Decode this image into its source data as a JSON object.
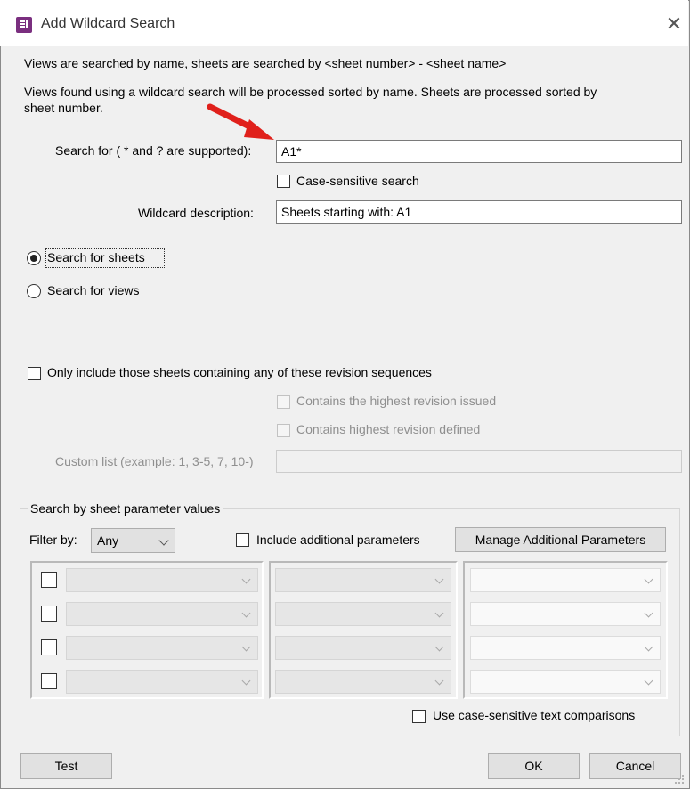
{
  "window": {
    "title": "Add Wildcard Search",
    "icon": "app-logo-icon",
    "close_glyph": "✕"
  },
  "intro": {
    "line1": "Views are searched by name, sheets are searched by <sheet number> - <sheet name>",
    "line2a": "Views found using a wildcard search will be processed sorted by name.  Sheets are processed sorted by",
    "line2b": "sheet number."
  },
  "search": {
    "label": "Search for ( * and ? are supported):",
    "value": "A1*"
  },
  "case_sensitive": {
    "label": "Case-sensitive search",
    "checked": false
  },
  "wildcard_description": {
    "label": "Wildcard description:",
    "value": "Sheets starting with: A1"
  },
  "mode": {
    "sheets_label": "Search for sheets",
    "views_label": "Search for views",
    "selected": "sheets"
  },
  "revisions": {
    "only_include_label": "Only include those sheets containing any of these revision sequences",
    "highest_issued_label": "Contains the highest revision issued",
    "highest_defined_label": "Contains highest revision defined",
    "custom_list_label": "Custom list (example:  1, 3-5, 7, 10-)",
    "custom_list_value": ""
  },
  "param_group": {
    "title": "Search by sheet parameter values",
    "filter_by_label": "Filter by:",
    "filter_by_value": "Any",
    "include_additional_label": "Include additional parameters",
    "manage_button": "Manage Additional Parameters",
    "rows": [
      {
        "param": "",
        "operator": "",
        "value": ""
      },
      {
        "param": "",
        "operator": "",
        "value": ""
      },
      {
        "param": "",
        "operator": "",
        "value": ""
      },
      {
        "param": "",
        "operator": "",
        "value": ""
      }
    ],
    "case_sensitive_compare_label": "Use case-sensitive text comparisons"
  },
  "buttons": {
    "test": "Test",
    "ok": "OK",
    "cancel": "Cancel"
  },
  "annotation": {
    "arrow_color": "#e0201b",
    "icon": "red-arrow-icon"
  }
}
